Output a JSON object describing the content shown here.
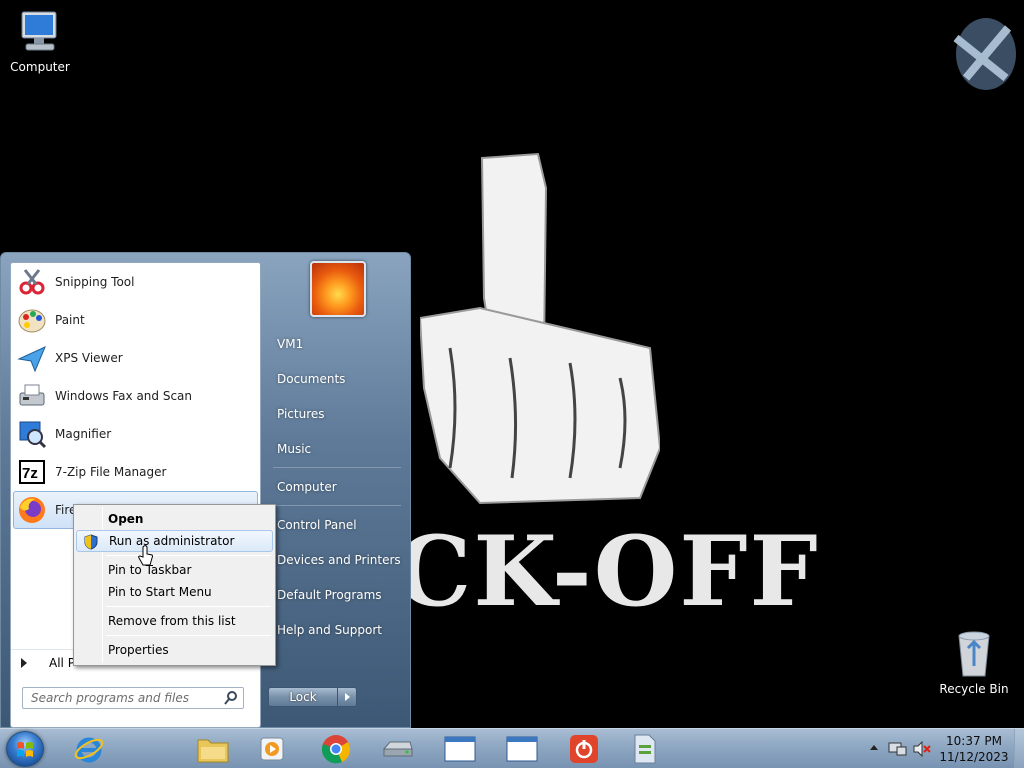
{
  "wallpaper": {
    "text": "CK-OFF"
  },
  "desktop": {
    "icons": [
      {
        "label": "Computer",
        "icon": "computer-icon"
      },
      {
        "label": "Recycle Bin",
        "icon": "recycle-bin-icon"
      }
    ]
  },
  "start_menu": {
    "programs": [
      {
        "label": "Snipping Tool",
        "icon": "snipping-tool-icon"
      },
      {
        "label": "Paint",
        "icon": "paint-icon"
      },
      {
        "label": "XPS Viewer",
        "icon": "xps-viewer-icon"
      },
      {
        "label": "Windows Fax and Scan",
        "icon": "fax-scan-icon"
      },
      {
        "label": "Magnifier",
        "icon": "magnifier-icon"
      },
      {
        "label": "7-Zip File Manager",
        "icon": "7zip-icon"
      },
      {
        "label": "Firef",
        "icon": "firefox-icon"
      }
    ],
    "all_programs": "All P",
    "search_placeholder": "Search programs and files",
    "right_items": {
      "user": "VM1",
      "documents": "Documents",
      "pictures": "Pictures",
      "music": "Music",
      "computer": "Computer",
      "control_panel": "Control Panel",
      "devices": "Devices and Printers",
      "default_programs": "Default Programs",
      "help": "Help and Support"
    },
    "lock_label": "Lock"
  },
  "context_menu": {
    "open": "Open",
    "run_as_admin": "Run as administrator",
    "pin_taskbar": "Pin to Taskbar",
    "pin_start": "Pin to Start Menu",
    "remove": "Remove from this list",
    "properties": "Properties"
  },
  "taskbar": {
    "pinned": [
      "internet-explorer-icon",
      "file-explorer-icon",
      "media-player-icon",
      "chrome-icon",
      "drive-icon",
      "window-icon",
      "window-icon",
      "power-icon",
      "document-icon"
    ],
    "clock_time": "10:37 PM",
    "clock_date": "11/12/2023"
  },
  "colors": {
    "start_menu_glass": "#5e7a98",
    "context_highlight": "#dbe9f8",
    "taskbar": "#8ea7c2"
  }
}
